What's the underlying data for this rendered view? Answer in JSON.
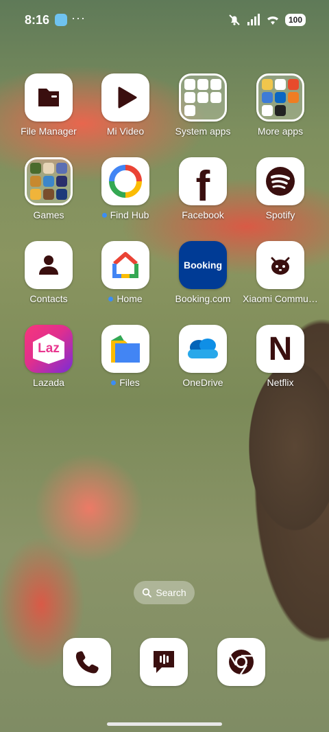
{
  "status_bar": {
    "time": "8:16",
    "more": "···",
    "battery": "100"
  },
  "apps": {
    "file_manager": "File Manager",
    "mi_video": "Mi Video",
    "system_apps": "System apps",
    "more_apps": "More apps",
    "games": "Games",
    "find_hub": "Find Hub",
    "facebook": "Facebook",
    "spotify": "Spotify",
    "contacts": "Contacts",
    "home": "Home",
    "booking": "Booking.com",
    "xiaomi_community": "Xiaomi Commu…",
    "lazada": "Lazada",
    "files": "Files",
    "onedrive": "OneDrive",
    "netflix": "Netflix"
  },
  "icon_text": {
    "booking": "Booking",
    "lazada": "Laz",
    "facebook": "f",
    "netflix": "N"
  },
  "search": {
    "label": "Search"
  },
  "colors": {
    "icon_dark": "#3a0f0f",
    "accent_blue": "#3b8df5",
    "booking_blue": "#003b95",
    "lazada_pink": "#e8368f"
  }
}
